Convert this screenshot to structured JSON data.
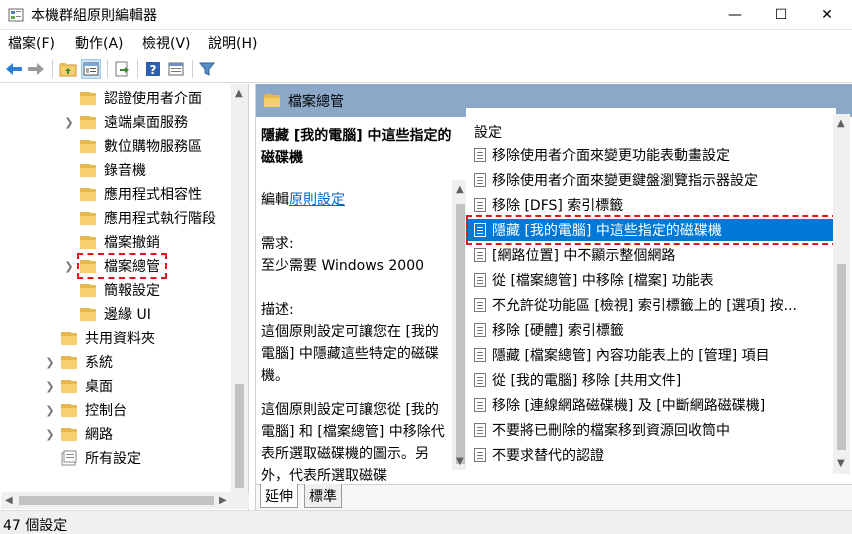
{
  "window": {
    "title": "本機群組原則編輯器",
    "min_glyph": "—",
    "max_glyph": "☐",
    "close_glyph": "✕"
  },
  "menu": [
    "檔案(F)",
    "動作(A)",
    "檢視(V)",
    "說明(H)"
  ],
  "toolbar": {
    "icons": [
      "back-arrow-icon",
      "forward-arrow-icon",
      "up-folder-icon",
      "show-hide-tree-icon",
      "export-list-icon",
      "help-icon",
      "properties-icon",
      "filter-icon"
    ]
  },
  "tree": {
    "items": [
      {
        "label": "認證使用者介面",
        "expandable": false
      },
      {
        "label": "遠端桌面服務",
        "expandable": true
      },
      {
        "label": "數位購物服務區",
        "expandable": false
      },
      {
        "label": "錄音機",
        "expandable": false
      },
      {
        "label": "應用程式相容性",
        "expandable": false
      },
      {
        "label": "應用程式執行階段",
        "expandable": false
      },
      {
        "label": "檔案撤銷",
        "expandable": false
      },
      {
        "label": "檔案總管",
        "expandable": true
      },
      {
        "label": "簡報設定",
        "expandable": false
      },
      {
        "label": "邊緣 UI",
        "expandable": false
      },
      {
        "label": "共用資料夾",
        "expandable": false
      },
      {
        "label": "系統",
        "expandable": true
      },
      {
        "label": "桌面",
        "expandable": true
      },
      {
        "label": "控制台",
        "expandable": true
      },
      {
        "label": "網路",
        "expandable": true
      },
      {
        "label": "所有設定",
        "expandable": false
      }
    ],
    "selected_index": 7
  },
  "right": {
    "header": "檔案總管",
    "description": {
      "title": "隱藏 [我的電腦] 中這些指定的磁碟機",
      "edit_prefix": "編輯",
      "edit_link": "原則設定",
      "req_label": "需求:",
      "req_value": "至少需要 Windows 2000",
      "desc_label": "描述:",
      "desc_p1": "這個原則設定可讓您在 [我的電腦] 中隱藏這些特定的磁碟機。",
      "desc_p2": "這個原則設定可讓您從 [我的電腦] 和 [檔案總管] 中移除代表所選取磁碟機的圖示。另外，代表所選取磁碟"
    },
    "list": {
      "header": "設定",
      "items": [
        "移除使用者介面來變更功能表動畫設定",
        "移除使用者介面來變更鍵盤瀏覽指示器設定",
        "移除 [DFS] 索引標籤",
        "隱藏 [我的電腦] 中這些指定的磁碟機",
        "[網路位置] 中不顯示整個網路",
        "從 [檔案總管] 中移除 [檔案] 功能表",
        "不允許從功能區 [檢視] 索引標籤上的 [選項] 按...",
        "移除 [硬體] 索引標籤",
        "隱藏 [檔案總管] 內容功能表上的 [管理] 項目",
        "從 [我的電腦] 移除 [共用文件]",
        "移除 [連線網路磁碟機] 及 [中斷網路磁碟機]",
        "不要將已刪除的檔案移到資源回收筒中",
        "不要求替代的認證"
      ],
      "selected_index": 3
    },
    "tabs": [
      "延伸",
      "標準"
    ]
  },
  "status": "47 個設定",
  "colors": {
    "accent": "#0078d7",
    "header_bg": "#8ba8c8",
    "highlight_dash": "#e0141e",
    "link": "#0066cc"
  }
}
